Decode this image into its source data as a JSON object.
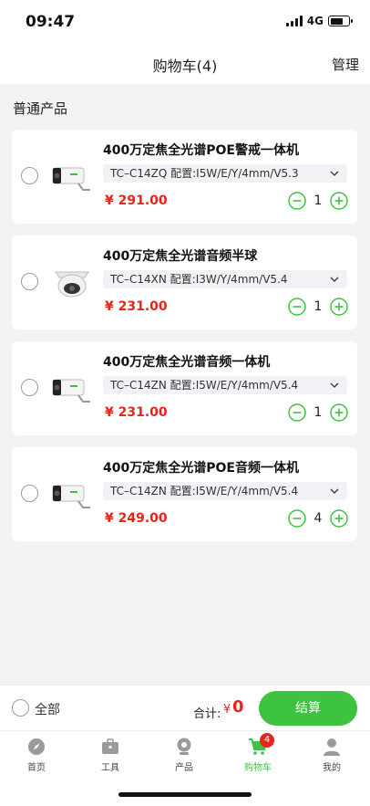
{
  "status_bar": {
    "time": "09:47",
    "network": "4G"
  },
  "nav": {
    "title": "购物车(4)",
    "manage": "管理"
  },
  "section_title": "普通产品",
  "items": [
    {
      "title": "400万定焦全光谱POE警戒一体机",
      "spec": "TC–C14ZQ 配置:I5W/E/Y/4mm/V5.3",
      "price": "¥ 291.00",
      "qty": "1",
      "thumb": "bullet-camera-icon"
    },
    {
      "title": "400万定焦全光谱音频半球",
      "spec": "TC–C14XN 配置:I3W/Y/4mm/V5.4",
      "price": "¥ 231.00",
      "qty": "1",
      "thumb": "dome-camera-icon"
    },
    {
      "title": "400万定焦全光谱音频一体机",
      "spec": "TC–C14ZN 配置:I5W/E/Y/4mm/V5.4",
      "price": "¥ 231.00",
      "qty": "1",
      "thumb": "bullet-camera-icon"
    },
    {
      "title": "400万定焦全光谱POE音频一体机",
      "spec": "TC–C14ZN 配置:I5W/E/Y/4mm/V5.4",
      "price": "¥ 249.00",
      "qty": "4",
      "thumb": "bullet-camera-icon"
    }
  ],
  "bottom": {
    "select_all": "全部",
    "total_label": "合计:",
    "total_currency": "¥",
    "total_value": "0",
    "checkout": "结算"
  },
  "tabs": [
    {
      "label": "首页",
      "icon": "compass-icon"
    },
    {
      "label": "工具",
      "icon": "toolbox-icon"
    },
    {
      "label": "产品",
      "icon": "camera-icon"
    },
    {
      "label": "购物车",
      "icon": "cart-icon",
      "badge": "4",
      "active": true
    },
    {
      "label": "我的",
      "icon": "user-icon"
    }
  ],
  "colors": {
    "accent": "#3dc33f",
    "price": "#e8251a",
    "badge": "#e8251a"
  }
}
